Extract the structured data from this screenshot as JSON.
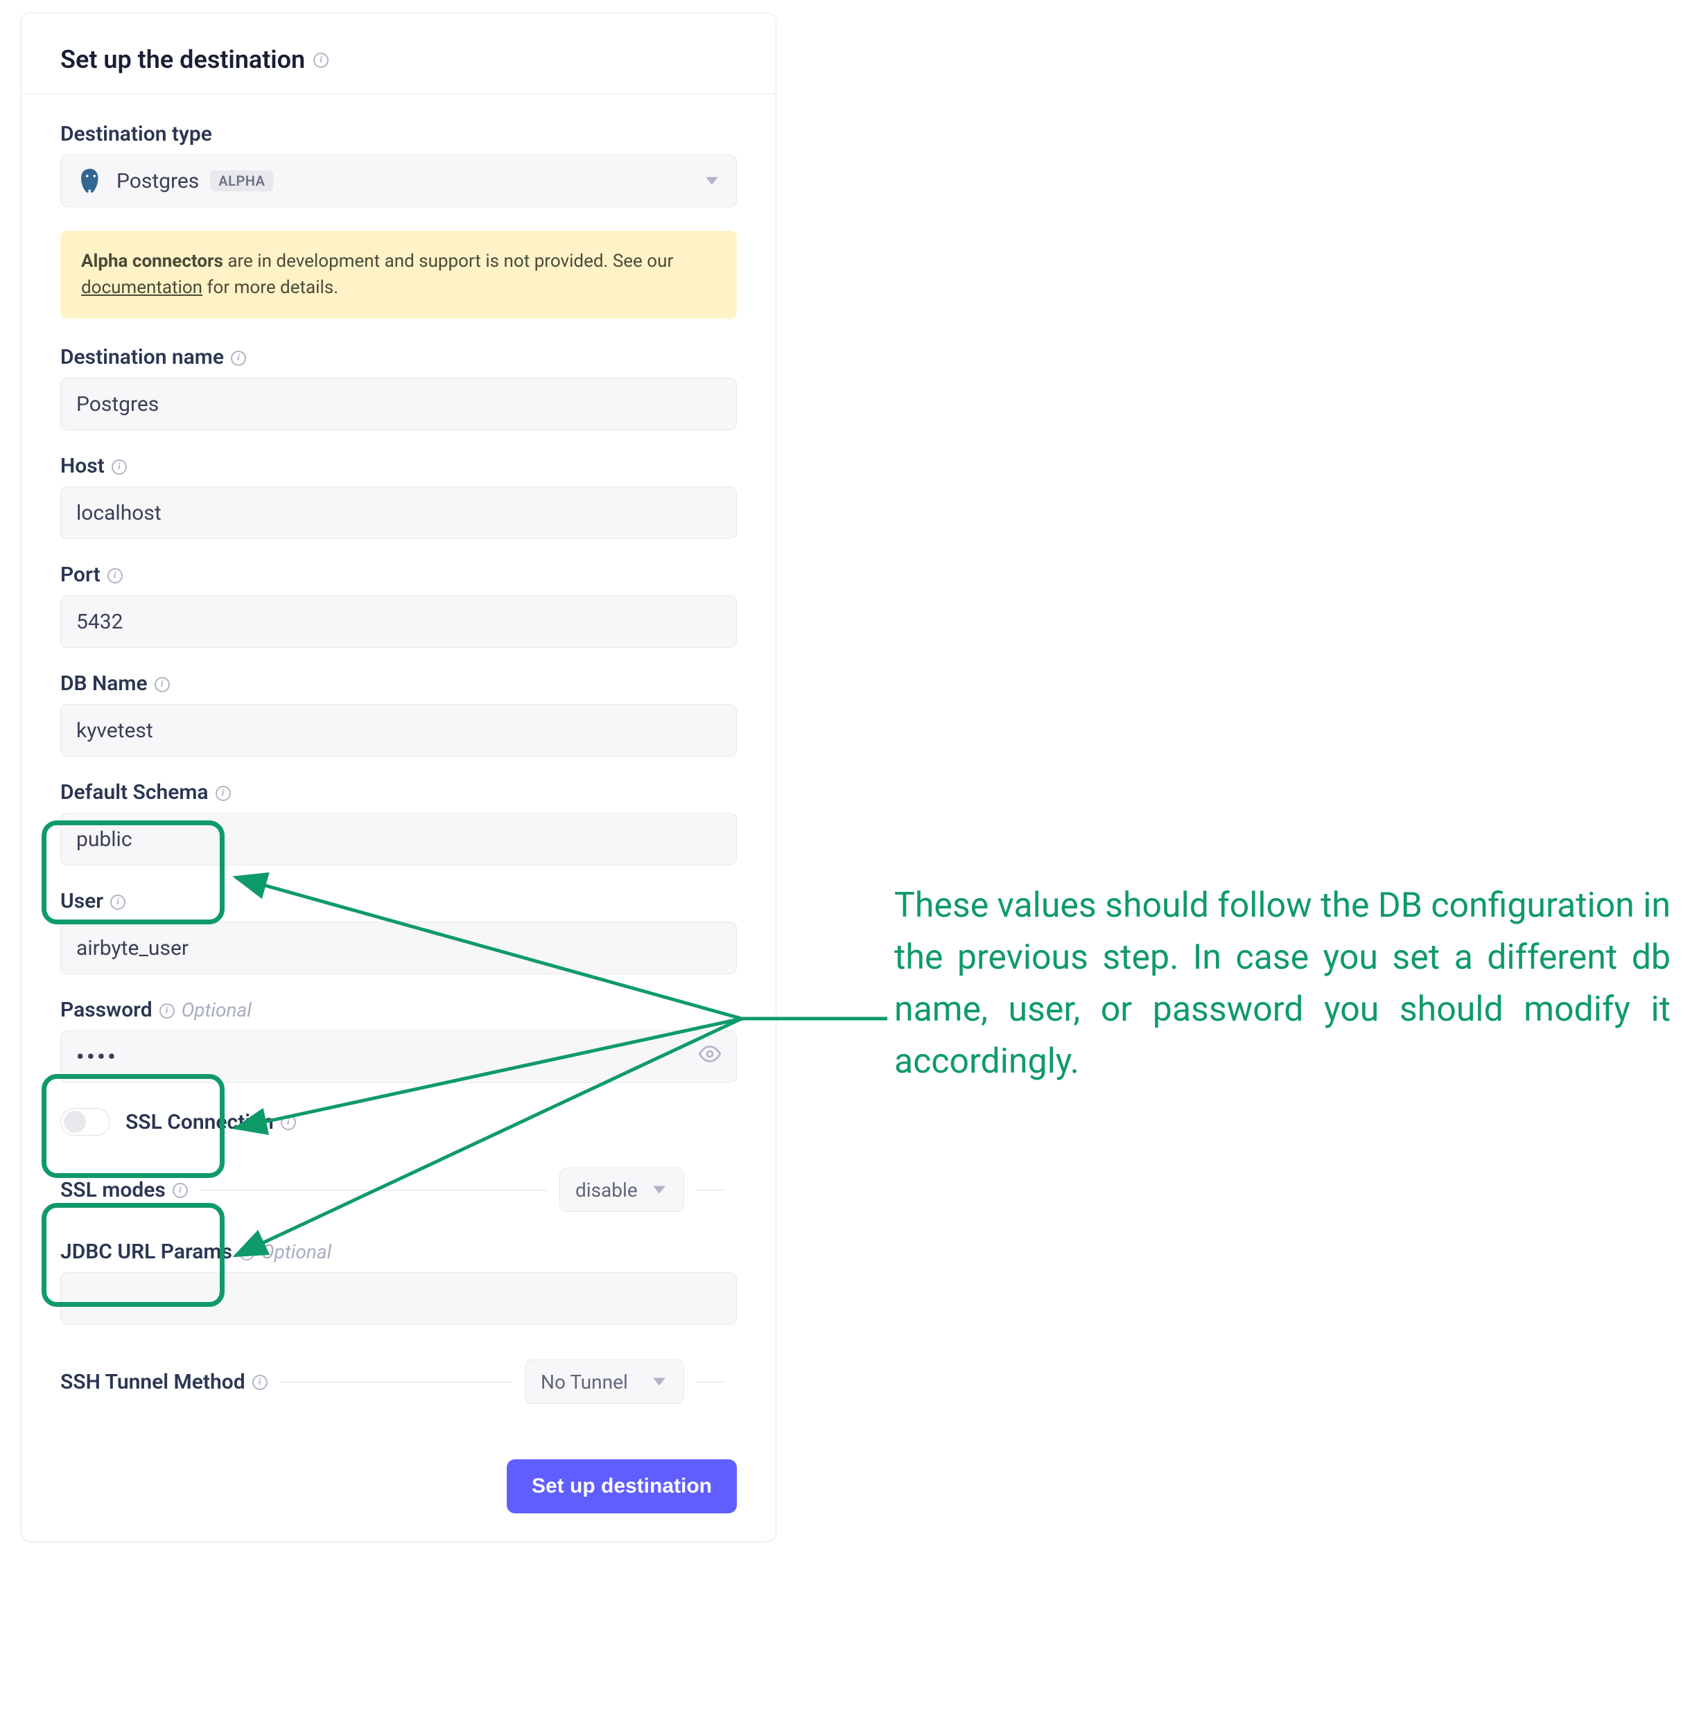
{
  "header": {
    "title": "Set up the destination"
  },
  "destination_type": {
    "label": "Destination type",
    "value": "Postgres",
    "badge": "ALPHA"
  },
  "alert": {
    "strong": "Alpha connectors",
    "rest": " are in development and support is not provided. See our ",
    "link": "documentation",
    "tail": " for more details."
  },
  "destination_name": {
    "label": "Destination name",
    "value": "Postgres"
  },
  "host": {
    "label": "Host",
    "value": "localhost"
  },
  "port": {
    "label": "Port",
    "value": "5432"
  },
  "db_name": {
    "label": "DB Name",
    "value": "kyvetest"
  },
  "default_schema": {
    "label": "Default Schema",
    "value": "public"
  },
  "user": {
    "label": "User",
    "value": "airbyte_user"
  },
  "password": {
    "label": "Password",
    "value": "••••",
    "optional": "Optional"
  },
  "ssl_connection": {
    "label": "SSL Connection"
  },
  "ssl_modes": {
    "label": "SSL modes",
    "value": "disable"
  },
  "jdbc": {
    "label": "JDBC URL Params",
    "optional": "Optional",
    "value": ""
  },
  "ssh": {
    "label": "SSH Tunnel Method",
    "value": "No Tunnel"
  },
  "submit": {
    "label": "Set up destination"
  },
  "annotation": {
    "text": "These values should follow the DB configuration in the previous step. In case you set a different db name, user, or password you should modify it accordingly."
  },
  "colors": {
    "highlight": "#0f9a6a",
    "primary_button": "#615eff",
    "alert_bg": "#fef3c7"
  }
}
